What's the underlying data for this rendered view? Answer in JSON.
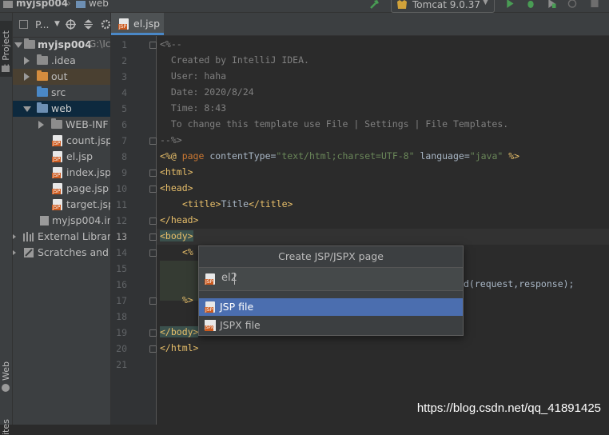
{
  "breadcrumbs": [
    "myjsp004",
    "web"
  ],
  "toolbar": {
    "run_config": "Tomcat 9.0.37"
  },
  "left_stripe": {
    "project_tab": "1: Project",
    "web_tab": "Web",
    "bottom_tab": "ites"
  },
  "project_panel": {
    "header": "P...",
    "tree": [
      {
        "label": "myjsp004",
        "path_hint": "G:\\Ic",
        "kind": "module",
        "expanded": true
      },
      {
        "label": ".idea",
        "kind": "folder",
        "expanded": false
      },
      {
        "label": "out",
        "kind": "folder-excluded",
        "expanded": false
      },
      {
        "label": "src",
        "kind": "source-folder"
      },
      {
        "label": "web",
        "kind": "web-folder",
        "expanded": true,
        "selected": true
      },
      {
        "label": "WEB-INF",
        "kind": "folder",
        "expanded": false
      },
      {
        "label": "count.jsp",
        "kind": "jsp"
      },
      {
        "label": "el.jsp",
        "kind": "jsp"
      },
      {
        "label": "index.jsp",
        "kind": "jsp"
      },
      {
        "label": "page.jsp",
        "kind": "jsp"
      },
      {
        "label": "target.jsp",
        "kind": "jsp"
      },
      {
        "label": "myjsp004.im",
        "kind": "iml"
      },
      {
        "label": "External Librarie",
        "kind": "libraries"
      },
      {
        "label": "Scratches and C",
        "kind": "scratches"
      }
    ]
  },
  "editor": {
    "tab": "el.jsp",
    "line_numbers": [
      "1",
      "2",
      "3",
      "4",
      "5",
      "6",
      "7",
      "8",
      "9",
      "10",
      "11",
      "12",
      "13",
      "14",
      "15",
      "16",
      "17",
      "18",
      "19",
      "20",
      "21"
    ],
    "current_line": "13",
    "lines": {
      "l1": "<%--",
      "l2": "  Created by IntelliJ IDEA.",
      "l3": "  User: haha",
      "l4": "  Date: 2020/8/24",
      "l5": "  Time: 8:43",
      "l6": "  To change this template use File | Settings | File Templates.",
      "l7": "--%>",
      "l8_a": "<%@ ",
      "l8_b": "page ",
      "l8_c": "contentType=",
      "l8_d": "\"text/html;charset=UTF-8\"",
      "l8_e": " language=",
      "l8_f": "\"java\"",
      "l8_g": " %>",
      "l9": "<html>",
      "l10": "<head>",
      "l11_open": "<title>",
      "l11_text": "Title",
      "l11_close": "</title>",
      "l12": "</head>",
      "l13": "<body>",
      "l14": "<%",
      "l16_tail": "d(request,response);",
      "l17": "%>",
      "l19": "</body>",
      "l20": "</html>"
    }
  },
  "popup": {
    "title": "Create JSP/JSPX page",
    "input_value": "el2",
    "options": [
      {
        "label": "JSP file",
        "selected": true
      },
      {
        "label": "JSPX file",
        "selected": false
      }
    ]
  },
  "watermark": "https://blog.csdn.net/qq_41891425"
}
